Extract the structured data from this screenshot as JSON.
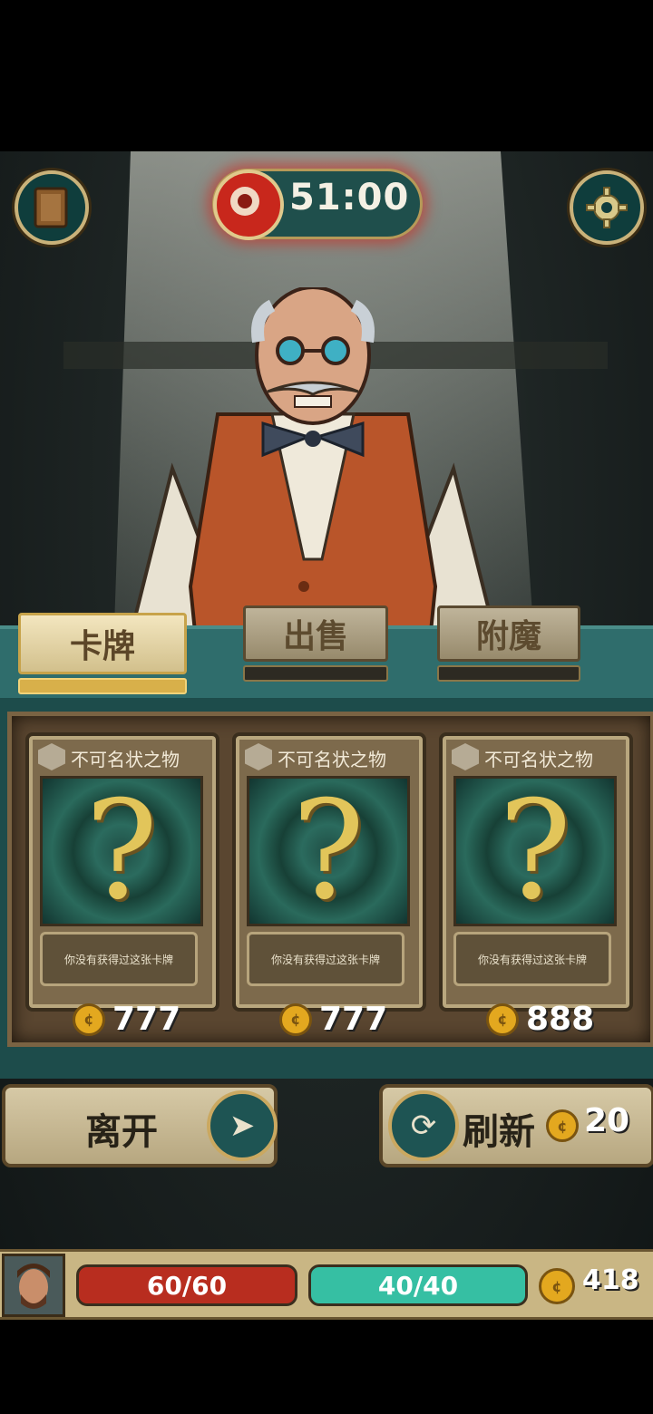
{
  "colors": {
    "accent_gold": "#c9b27a",
    "timer_red": "#c8271c",
    "counter_teal": "#2f6d6c",
    "hp_red": "#b82d1f",
    "mana_teal": "#36bfa3"
  },
  "hud": {
    "journal_icon": "book-icon",
    "settings_icon": "gear-icon",
    "timer_icon": "eye-icon",
    "timer": "51:00"
  },
  "tabs": [
    {
      "label": "卡牌",
      "active": true
    },
    {
      "label": "出售",
      "active": false
    },
    {
      "label": "附魔",
      "active": false
    }
  ],
  "cards": [
    {
      "name": "不可名状之物",
      "symbol": "?",
      "description": "你没有获得过这张卡牌",
      "price": "777"
    },
    {
      "name": "不可名状之物",
      "symbol": "?",
      "description": "你没有获得过这张卡牌",
      "price": "777"
    },
    {
      "name": "不可名状之物",
      "symbol": "?",
      "description": "你没有获得过这张卡牌",
      "price": "888"
    }
  ],
  "actions": {
    "leave_label": "离开",
    "leave_icon": "arrow-right-icon",
    "refresh_label": "刷新",
    "refresh_icon": "refresh-icon",
    "refresh_cost": "20"
  },
  "status": {
    "hp": "60/60",
    "hp_fraction": 1.0,
    "mana": "40/40",
    "mana_fraction": 1.0,
    "gold": "418"
  }
}
